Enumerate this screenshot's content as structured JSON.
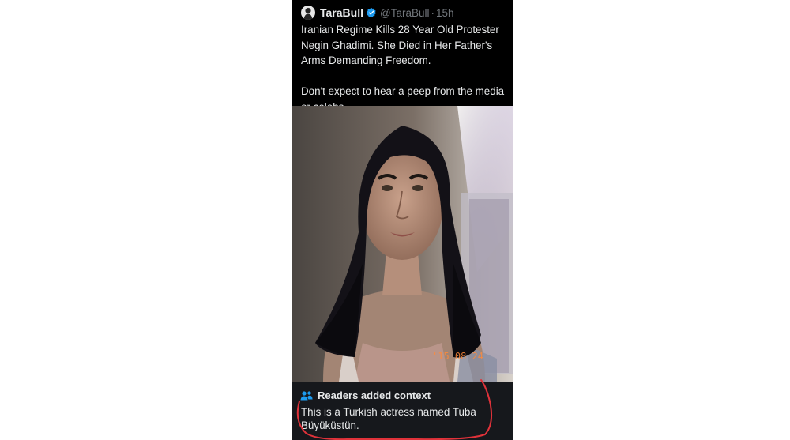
{
  "tweet": {
    "author_name": "TaraBull",
    "author_handle": "@TaraBull",
    "separator": "·",
    "time": "15h",
    "text_paragraphs": [
      "Iranian Regime Kills 28 Year Old Protester Negin Ghadimi. She Died in Her Father's Arms Demanding Freedom.",
      "Don't expect to hear a peep from the media or celebs"
    ],
    "photo_timestamp": "'15 08 24"
  },
  "community_note": {
    "title": "Readers added context",
    "body": "This is a Turkish actress named Tuba Büyüküstün."
  },
  "colors": {
    "background": "#ffffff",
    "card": "#000000",
    "note_panel": "#16181c",
    "verified": "#1d9bf0",
    "annotation": "#e0323a"
  },
  "icons": [
    "avatar-icon",
    "verified-badge-icon",
    "readers-people-icon"
  ]
}
